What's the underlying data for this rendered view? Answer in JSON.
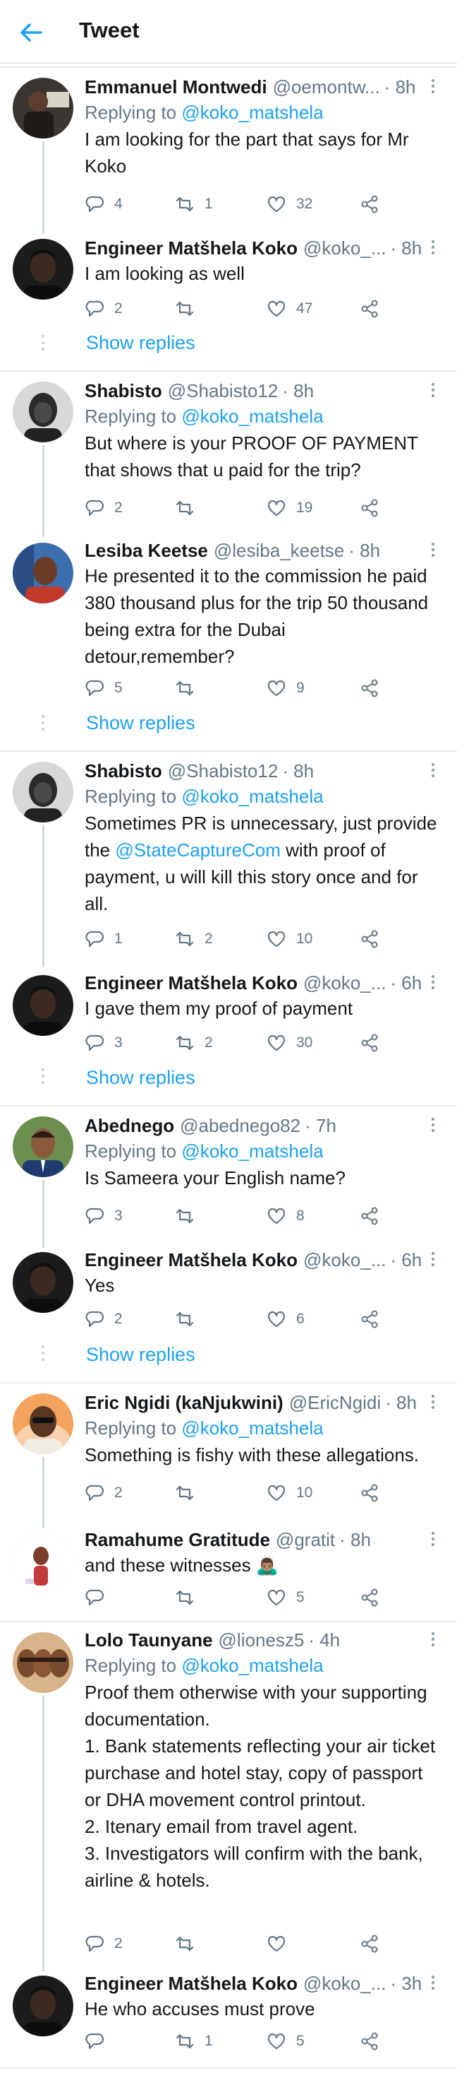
{
  "header": {
    "title": "Tweet",
    "back_icon": "arrow-left-icon",
    "accent": "#1da1f2"
  },
  "tweets": [
    {
      "name": "Emmanuel Montwedi",
      "handle": "@oemontw...",
      "time": "· 8h",
      "reply_prefix": "Replying to",
      "reply_to": "@koko_matshela",
      "text": "I am looking for the part that says for Mr Koko",
      "replies": "4",
      "retweets": "1",
      "likes": "32"
    },
    {
      "name": "Engineer Matšhela Koko",
      "handle": "@koko_...",
      "time": "· 8h",
      "text": "I am looking as well",
      "replies": "2",
      "retweets": "",
      "likes": "47"
    },
    {
      "name": "Shabisto",
      "handle": "@Shabisto12",
      "time": "· 8h",
      "reply_prefix": "Replying to",
      "reply_to": "@koko_matshela",
      "text": "But where is your PROOF OF PAYMENT that shows that u paid for the trip?",
      "replies": "2",
      "retweets": "",
      "likes": "19"
    },
    {
      "name": "Lesiba Keetse",
      "handle": "@lesiba_keetse",
      "time": "· 8h",
      "text": "He presented it to the commission he paid 380 thousand plus for the trip 50 thousand being extra for the Dubai detour,remember?",
      "replies": "5",
      "retweets": "",
      "likes": "9"
    },
    {
      "name": "Shabisto",
      "handle": "@Shabisto12",
      "time": "· 8h",
      "reply_prefix": "Replying to",
      "reply_to": "@koko_matshela",
      "text_a": "Sometimes PR is unnecessary, just provide the ",
      "mention": "@StateCaptureCom",
      "text_b": " with proof of payment, u will kill this story once and for all.",
      "replies": "1",
      "retweets": "2",
      "likes": "10"
    },
    {
      "name": "Engineer Matšhela Koko",
      "handle": "@koko_...",
      "time": "· 6h",
      "text": "I gave them my proof of payment",
      "replies": "3",
      "retweets": "2",
      "likes": "30"
    },
    {
      "name": "Abednego",
      "handle": "@abednego82",
      "time": "· 7h",
      "reply_prefix": "Replying to",
      "reply_to": "@koko_matshela",
      "text": "Is Sameera your English name?",
      "replies": "3",
      "retweets": "",
      "likes": "8"
    },
    {
      "name": "Engineer Matšhela Koko",
      "handle": "@koko_...",
      "time": "· 6h",
      "text": "Yes",
      "replies": "2",
      "retweets": "",
      "likes": "6"
    },
    {
      "name": "Eric Ngidi (kaNjukwini)",
      "handle": "@EricNgidi",
      "time": "· 8h",
      "reply_prefix": "Replying to",
      "reply_to": "@koko_matshela",
      "text": "Something is fishy with these allegations.",
      "replies": "2",
      "retweets": "",
      "likes": "10"
    },
    {
      "name": "Ramahume Gratitude",
      "handle": "@gratit",
      "time": "· 8h",
      "text": "and these witnesses 🙇🏽‍♂️",
      "replies": "",
      "retweets": "",
      "likes": "5"
    },
    {
      "name": "Lolo Taunyane",
      "handle": "@lionesz5",
      "time": "· 4h",
      "reply_prefix": "Replying to",
      "reply_to": "@koko_matshela",
      "text_lines": [
        "Proof them otherwise with your supporting documentation.",
        "1. Bank statements reflecting your air ticket purchase and hotel stay, copy of passport or DHA movement control printout.",
        "2. Itenary email from travel agent.",
        "3. Investigators will confirm with the bank, airline & hotels."
      ],
      "replies": "2",
      "retweets": "",
      "likes": ""
    },
    {
      "name": "Engineer Matšhela Koko",
      "handle": "@koko_...",
      "time": "· 3h",
      "text": "He who accuses must prove",
      "replies": "",
      "retweets": "1",
      "likes": "5"
    }
  ],
  "show_replies_label": "Show replies",
  "icons": {
    "reply": "reply-icon",
    "retweet": "retweet-icon",
    "like": "heart-icon",
    "share": "share-icon",
    "more": "more-vertical-icon"
  }
}
